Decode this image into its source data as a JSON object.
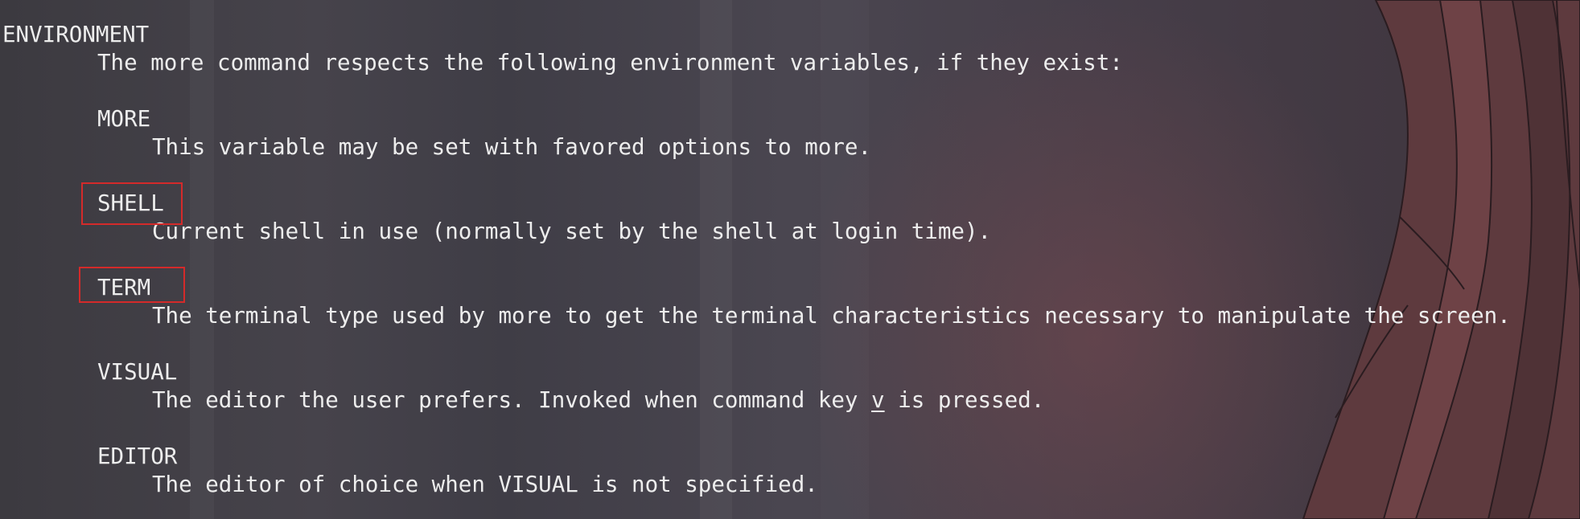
{
  "section_heading": "ENVIRONMENT",
  "intro": "The more command respects the following environment variables, if they exist:",
  "variables": [
    {
      "name": "MORE",
      "description": "This variable may be set with favored options to more."
    },
    {
      "name": "SHELL",
      "description": "Current shell in use (normally set by the shell at login time)."
    },
    {
      "name": "TERM",
      "description": "The terminal type used by more to get the terminal characteristics necessary to manipulate the screen."
    },
    {
      "name": "VISUAL",
      "description_before": "The editor the user prefers. Invoked when command key ",
      "description_key": "v",
      "description_after": " is pressed."
    },
    {
      "name": "EDITOR",
      "description": "The editor of choice when VISUAL is not specified."
    }
  ],
  "highlight_color": "#d42a2a",
  "text_color": "#ededed"
}
